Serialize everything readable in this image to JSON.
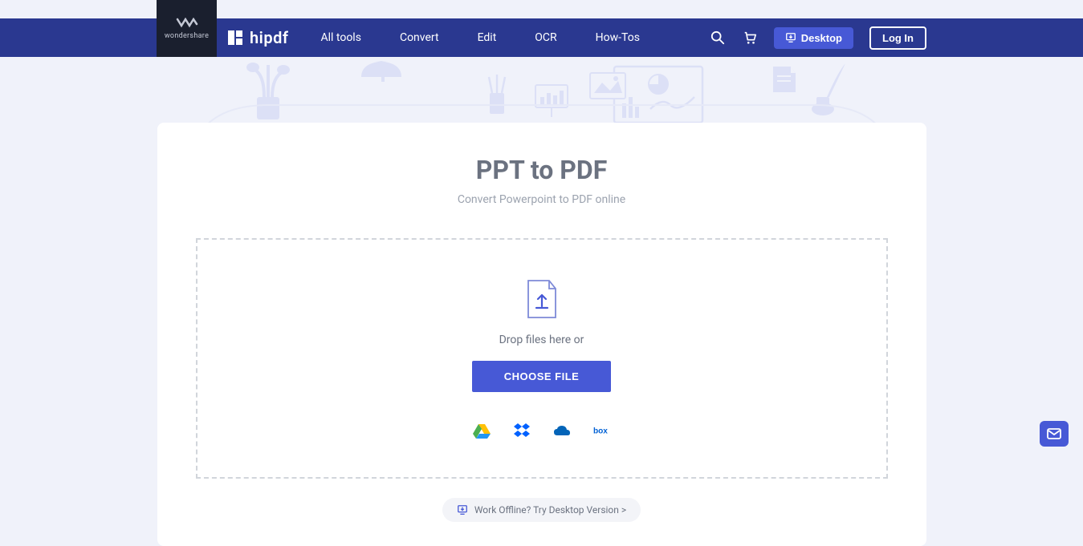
{
  "brand": {
    "parent": "wondershare",
    "name": "hipdf"
  },
  "nav": {
    "all_tools": "All tools",
    "convert": "Convert",
    "edit": "Edit",
    "ocr": "OCR",
    "howtos": "How-Tos"
  },
  "header": {
    "desktop": "Desktop",
    "login": "Log In"
  },
  "page": {
    "title": "PPT to PDF",
    "subtitle": "Convert Powerpoint to PDF online"
  },
  "upload": {
    "drop_text": "Drop files here or",
    "choose_file": "CHOOSE FILE"
  },
  "offline": {
    "text": "Work Offline? Try Desktop Version >"
  }
}
